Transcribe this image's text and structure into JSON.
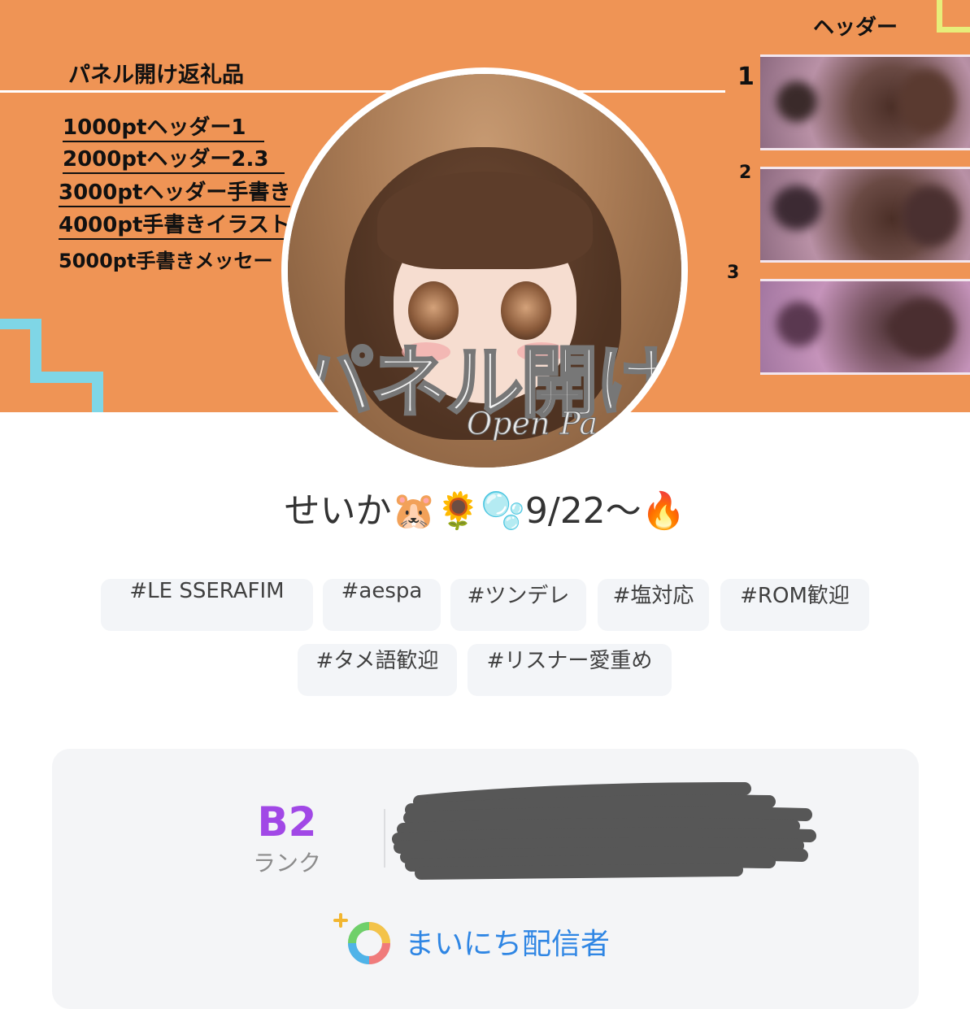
{
  "banner": {
    "reward_title": "パネル開け返礼品",
    "reward_items": [
      "1000ptヘッダー1",
      "2000ptヘッダー2.3",
      "3000ptヘッダー手書き",
      "4000pt手書きイラスト",
      "5000pt手書きメッセー"
    ],
    "header_label": "ヘッダー",
    "header_numbers": [
      "1",
      "2",
      "3"
    ],
    "avatar_text": "パネル開け",
    "avatar_subtext": "Open Pa"
  },
  "profile": {
    "name": "せいか🐹🌻🫧9/22〜🔥"
  },
  "tags": [
    "#LE SSERAFIM",
    "#aespa",
    "#ツンデレ",
    "#塩対応",
    "#ROM歓迎",
    "#タメ語歓迎",
    "#リスナー愛重め"
  ],
  "rank": {
    "value": "B2",
    "label": "ランク"
  },
  "daily": {
    "label": "まいにち配信者"
  },
  "colors": {
    "banner_bg": "#ef9455",
    "rank_accent": "#a148e6",
    "daily_accent": "#2f86e4",
    "tag_bg": "#f3f5f8"
  }
}
